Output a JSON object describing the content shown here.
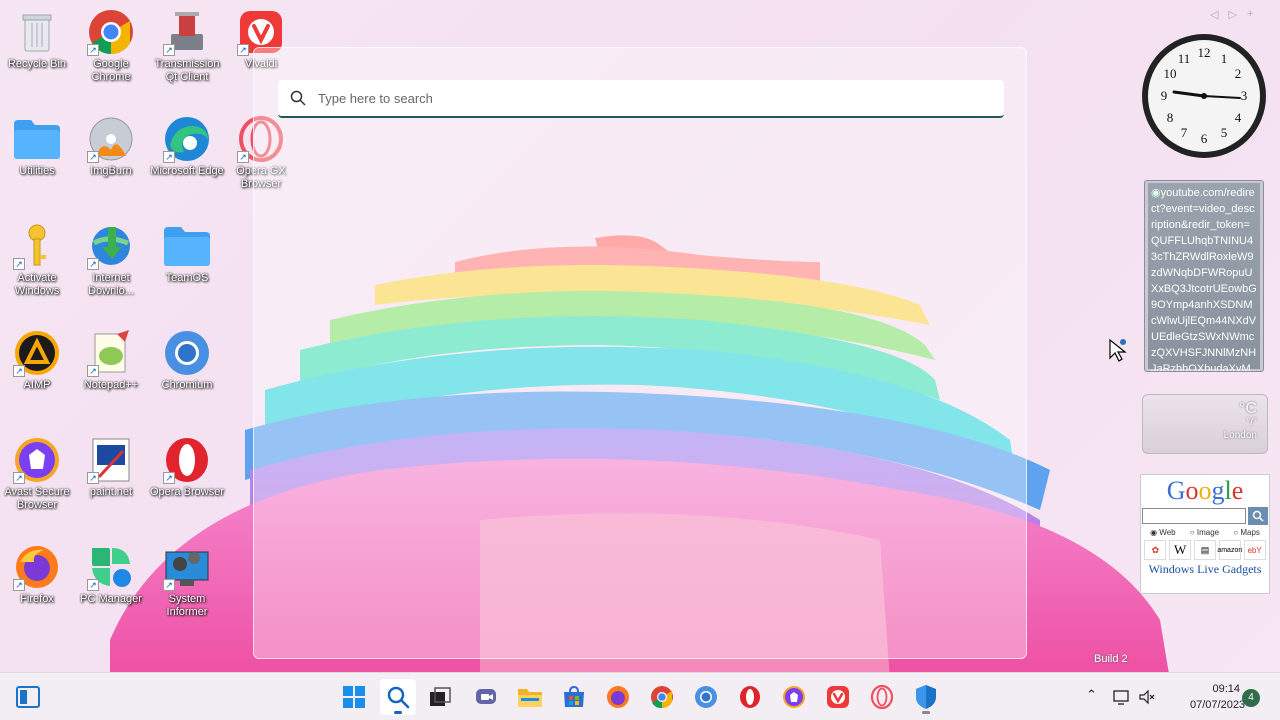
{
  "desktop": {
    "icons": [
      {
        "label": "Recycle Bin"
      },
      {
        "label": "Google Chrome"
      },
      {
        "label": "Transmission Qt Client"
      },
      {
        "label": "Vivaldi"
      },
      {
        "label": "Utilities"
      },
      {
        "label": "ImgBurn"
      },
      {
        "label": "Microsoft Edge"
      },
      {
        "label": "Opera GX Browser"
      },
      {
        "label": "Activate Windows"
      },
      {
        "label": "Internet Downlo..."
      },
      {
        "label": "TeamOS"
      },
      {
        "label": "AIMP"
      },
      {
        "label": "Notepad++"
      },
      {
        "label": "Chromium"
      },
      {
        "label": "Avast Secure Browser"
      },
      {
        "label": "paint.net"
      },
      {
        "label": "Opera Browser"
      },
      {
        "label": "Firefox"
      },
      {
        "label": "PC Manager"
      },
      {
        "label": "System Informer"
      }
    ]
  },
  "search": {
    "placeholder": "Type here to search"
  },
  "gadgets": {
    "feed_text": "youtube.com/redirect?event=video_description&redir_token=QUFFLUhqbTNINU43cThZRWdlRoxleW9zdWNqbDFWRopuUXxBQ3JtcotrUEowbG9OYmp4anhXSDNMcWlwUjlEQm44NXdVUEdleGtzSWxNWmczQXVHSFJNNlMzNHJaRzhhOXhudaXvMmsL",
    "weather_deg": "°C",
    "weather_hilo": "°/°",
    "weather_city": "London",
    "google_logo": "Google",
    "radio_web": "Web",
    "radio_image": "Image",
    "radio_maps": "Maps",
    "wlg_label": "Windows Live Gadgets",
    "build_text": "Build 2"
  },
  "taskbar": {
    "time": "09:14",
    "date": "07/07/2023",
    "notification_count": "4"
  },
  "colors": {
    "accent": "#1f5a5a",
    "taskbar_bg": "#f3eef3"
  }
}
